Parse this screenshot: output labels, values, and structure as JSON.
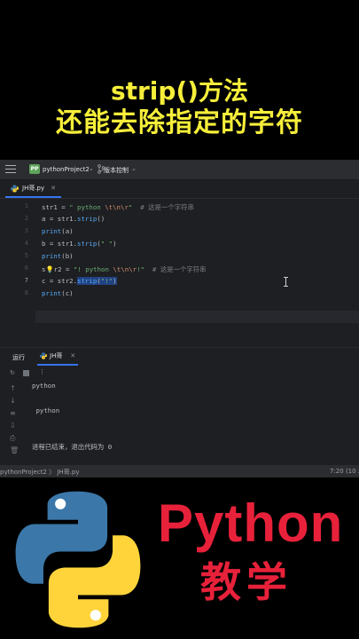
{
  "caption": {
    "line1": "strip()方法",
    "line2": "还能去除指定的字符"
  },
  "ide": {
    "project_badge": "PP",
    "project_name": "pythonProject2",
    "vcs_label": "版本控制",
    "file_tab": "JH哥.py",
    "line_numbers": [
      "1",
      "2",
      "3",
      "4",
      "5",
      "6",
      "7",
      "8"
    ],
    "current_line": "7",
    "code": {
      "l1": {
        "var": "str1 = ",
        "str_a": "\" python ",
        "esc": "\\t\\n\\r",
        "str_b": "\"",
        "comment": "  # 这是一个字符串"
      },
      "l2": {
        "a": "a = str1.",
        "fn": "strip",
        "b": "()"
      },
      "l3": {
        "fn": "print",
        "b": "(a)"
      },
      "l4": {
        "a": "b = str1.",
        "fn": "strip",
        "b": "(",
        "str": "\" \"",
        "c": ")"
      },
      "l5": {
        "fn": "print",
        "b": "(b)"
      },
      "l6": {
        "a": "s",
        "b": "r2 = ",
        "str_a": "\"! python ",
        "esc": "\\t\\n\\r",
        "str_b": "!\"",
        "comment": "  # 这是一个字符串"
      },
      "l7": {
        "a": "c = str2.",
        "fn": "strip",
        "b": "(",
        "str": "\"!\"",
        "c": ")"
      },
      "l8": {
        "fn": "print",
        "b": "(c)"
      }
    },
    "run": {
      "label": "运行",
      "tab": "JH哥",
      "output_1": "python",
      "output_2": " python",
      "exit_message": "进程已结束，退出代码为 0"
    },
    "statusbar": {
      "path": "pythonProject2 〉 JH哥.py",
      "position": "7:20 (10 ."
    }
  },
  "brand": {
    "name": "Python",
    "subtitle": "教学",
    "colors": {
      "caption": "#f6ee3a",
      "brand_red": "#e8213a",
      "python_blue": "#3b77a8",
      "python_yellow": "#ffd43b"
    }
  }
}
